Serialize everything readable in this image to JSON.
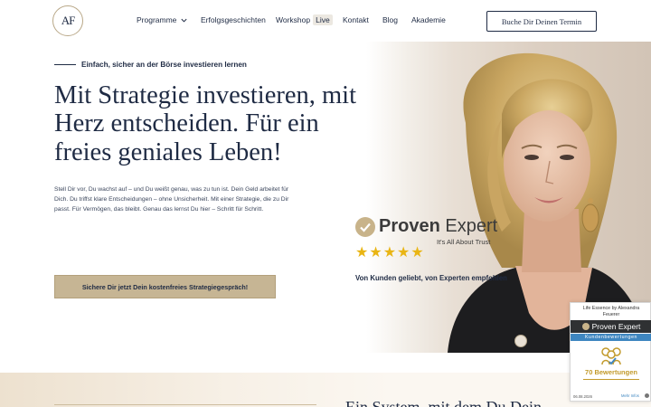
{
  "header": {
    "logo_text": "AF",
    "nav": [
      {
        "label": "Programme",
        "has_dropdown": true
      },
      {
        "label": "Erfolgsgeschichten"
      },
      {
        "label": "Workshop",
        "badge": "Live"
      },
      {
        "label": "Kontakt"
      },
      {
        "label": "Blog"
      },
      {
        "label": "Akademie"
      }
    ],
    "cta": "Buche Dir Deinen Termin"
  },
  "hero": {
    "kicker": "Einfach, sicher an der Börse investieren lernen",
    "headline": "Mit Strategie investieren, mit Herz entscheiden. Für ein freies geniales Leben!",
    "intro": "Stell Dir vor, Du wachst auf – und Du weißt genau, was zu tun ist. Dein Geld arbeitet für Dich. Du triffst klare Entscheidungen – ohne Unsicherheit. Mit einer Strategie, die zu Dir passt. Für Vermögen, das bleibt. Genau das lernst Du hier – Schritt für Schritt.",
    "cta": "Sichere Dir jetzt Dein kostenfreies Strategiegespräch!"
  },
  "proven_expert": {
    "brand_first": "Proven",
    "brand_second": "Expert",
    "tagline": "It's All About Trust",
    "stars": 5,
    "caption": "Von Kunden geliebt, von Experten empfohlen"
  },
  "section2": {
    "title": "Ein System, mit dem Du Dein"
  },
  "widget": {
    "name": "Life Essence by Alexandra Feuerer",
    "brand": "Proven Expert",
    "subtitle": "Kundenbewertungen",
    "count": "70 Bewertungen",
    "date": "06.08.2026",
    "more": "Mehr Infos"
  },
  "colors": {
    "navy": "#1f2b44",
    "gold": "#c6b594",
    "star": "#e9b514",
    "widget_blue": "#3e86c0"
  }
}
